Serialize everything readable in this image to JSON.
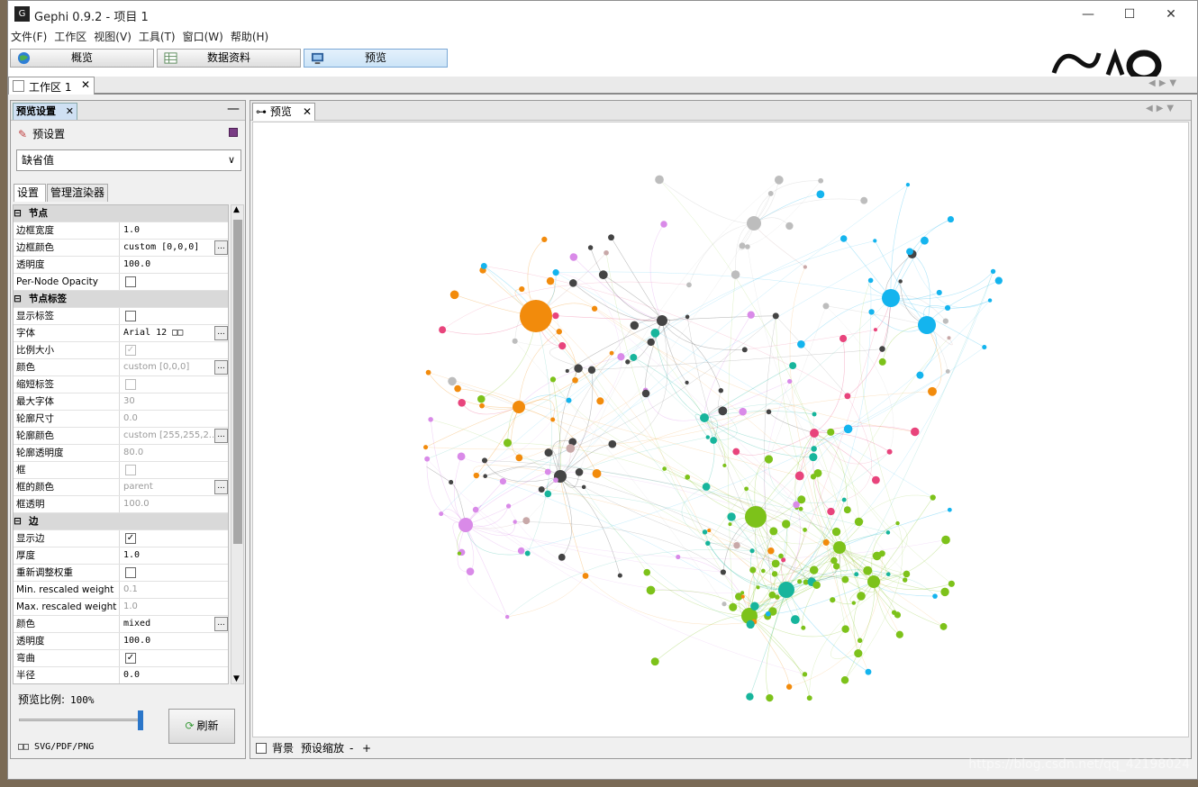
{
  "window": {
    "title": "Gephi 0.9.2 - 项目 1",
    "controls": {
      "minimize": "—",
      "maximize": "☐",
      "close": "✕"
    }
  },
  "menu": [
    "文件(F)",
    "工作区",
    "视图(V)",
    "工具(T)",
    "窗口(W)",
    "帮助(H)"
  ],
  "toolbar": {
    "overview": "概览",
    "data_lab": "数据资料",
    "preview": "预览"
  },
  "workspace_tab": {
    "label": "工作区 1",
    "close": "✕"
  },
  "left_panel": {
    "tab_label": "预览设置",
    "tab_close": "✕",
    "minimize": "—",
    "preset_label": "预设置",
    "preset_value": "缺省值",
    "subtabs": [
      "设置",
      "管理渲染器"
    ],
    "rows": [
      {
        "type": "cat",
        "label": "节点"
      },
      {
        "label": "边框宽度",
        "value": "1.0"
      },
      {
        "label": "边框颜色",
        "value": "custom [0,0,0]",
        "dots": true
      },
      {
        "label": "透明度",
        "value": "100.0"
      },
      {
        "label": "Per-Node Opacity",
        "checkbox": false
      },
      {
        "type": "cat",
        "label": "节点标签"
      },
      {
        "label": "显示标签",
        "checkbox": false
      },
      {
        "label": "字体",
        "value": "Arial 12 □□",
        "dots": true
      },
      {
        "label": "比例大小",
        "checkbox": true,
        "disabled": true
      },
      {
        "label": "颜色",
        "value": "custom [0,0,0]",
        "disabled": true,
        "dots": true
      },
      {
        "label": "缩短标签",
        "checkbox": false,
        "disabled": true
      },
      {
        "label": "最大字体",
        "value": "30",
        "disabled": true
      },
      {
        "label": "轮廓尺寸",
        "value": "0.0",
        "disabled": true
      },
      {
        "label": "轮廓颜色",
        "value": "custom [255,255,2...",
        "disabled": true,
        "dots": true
      },
      {
        "label": "轮廓透明度",
        "value": "80.0",
        "disabled": true
      },
      {
        "label": "框",
        "checkbox": false,
        "disabled": true
      },
      {
        "label": "框的颜色",
        "value": "parent",
        "disabled": true,
        "dots": true
      },
      {
        "label": "框透明",
        "value": "100.0",
        "disabled": true
      },
      {
        "type": "cat",
        "label": "边"
      },
      {
        "label": "显示边",
        "checkbox": true
      },
      {
        "label": "厚度",
        "value": "1.0"
      },
      {
        "label": "重新调整权重",
        "checkbox": false
      },
      {
        "label": "Min. rescaled weight",
        "value": "0.1",
        "disabled": true
      },
      {
        "label": "Max. rescaled weight",
        "value": "1.0",
        "disabled": true
      },
      {
        "label": "颜色",
        "value": "mixed",
        "dots": true
      },
      {
        "label": "透明度",
        "value": "100.0"
      },
      {
        "label": "弯曲",
        "checkbox": true
      },
      {
        "label": "半径",
        "value": "0.0"
      }
    ],
    "ratio_label": "预览比例:",
    "ratio_value": "100%",
    "ratio_fraction": 1.0,
    "refresh_label": "刷新",
    "export_label": "□□  SVG/PDF/PNG"
  },
  "right_panel": {
    "tab_label": "预览",
    "tab_close": "✕",
    "background_label": "背景",
    "zoom_label": "预设缩放",
    "zoom_minus": "-",
    "zoom_plus": "+"
  },
  "graph_colors": {
    "orange": "#f28b0c",
    "cyan": "#14b4ee",
    "green": "#7dc21a",
    "teal": "#17b59c",
    "pink": "#e8447c",
    "violet": "#d98ae8",
    "dark": "#444444",
    "gray": "#bdbdbd",
    "rose_gray": "#c8a8a8"
  },
  "watermark": "https://blog.csdn.net/qq_42198024"
}
